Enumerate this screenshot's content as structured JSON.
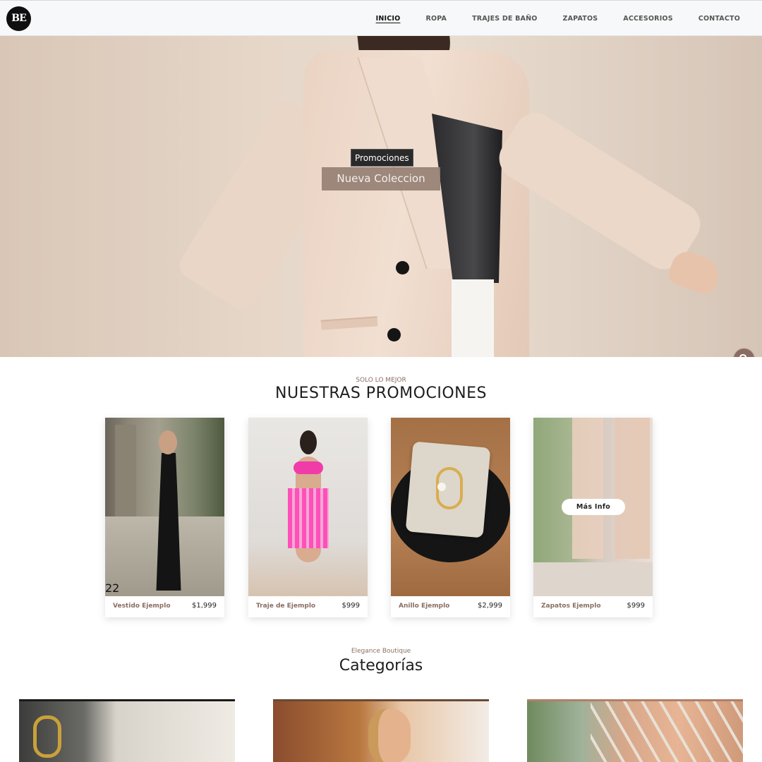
{
  "header": {
    "logo_text": "BE",
    "nav": [
      {
        "label": "INICIO",
        "active": true
      },
      {
        "label": "ROPA",
        "active": false
      },
      {
        "label": "TRAJES DE BAÑO",
        "active": false
      },
      {
        "label": "ZAPATOS",
        "active": false
      },
      {
        "label": "ACCESORIOS",
        "active": false
      },
      {
        "label": "CONTACTO",
        "active": false
      }
    ]
  },
  "hero": {
    "tag": "Promociones",
    "title": "Nueva Coleccion",
    "search_icon": "search-icon"
  },
  "promotions": {
    "kicker": "SOLO LO MEJOR",
    "title": "NUESTRAS PROMOCIONES",
    "number_overlay": "22",
    "more_info_label": "Más Info",
    "cards": [
      {
        "name": "Vestido Ejemplo",
        "price": "$1,999"
      },
      {
        "name": "Traje de Ejemplo",
        "price": "$999"
      },
      {
        "name": "Anillo Ejemplo",
        "price": "$2,999"
      },
      {
        "name": "Zapatos Ejemplo",
        "price": "$999"
      }
    ]
  },
  "categories": {
    "kicker": "Elegance Boutique",
    "title": "Categorías"
  },
  "colors": {
    "accent": "#8a6e62",
    "hero_title_bg": "#968074",
    "fab": "#8b6c64"
  }
}
